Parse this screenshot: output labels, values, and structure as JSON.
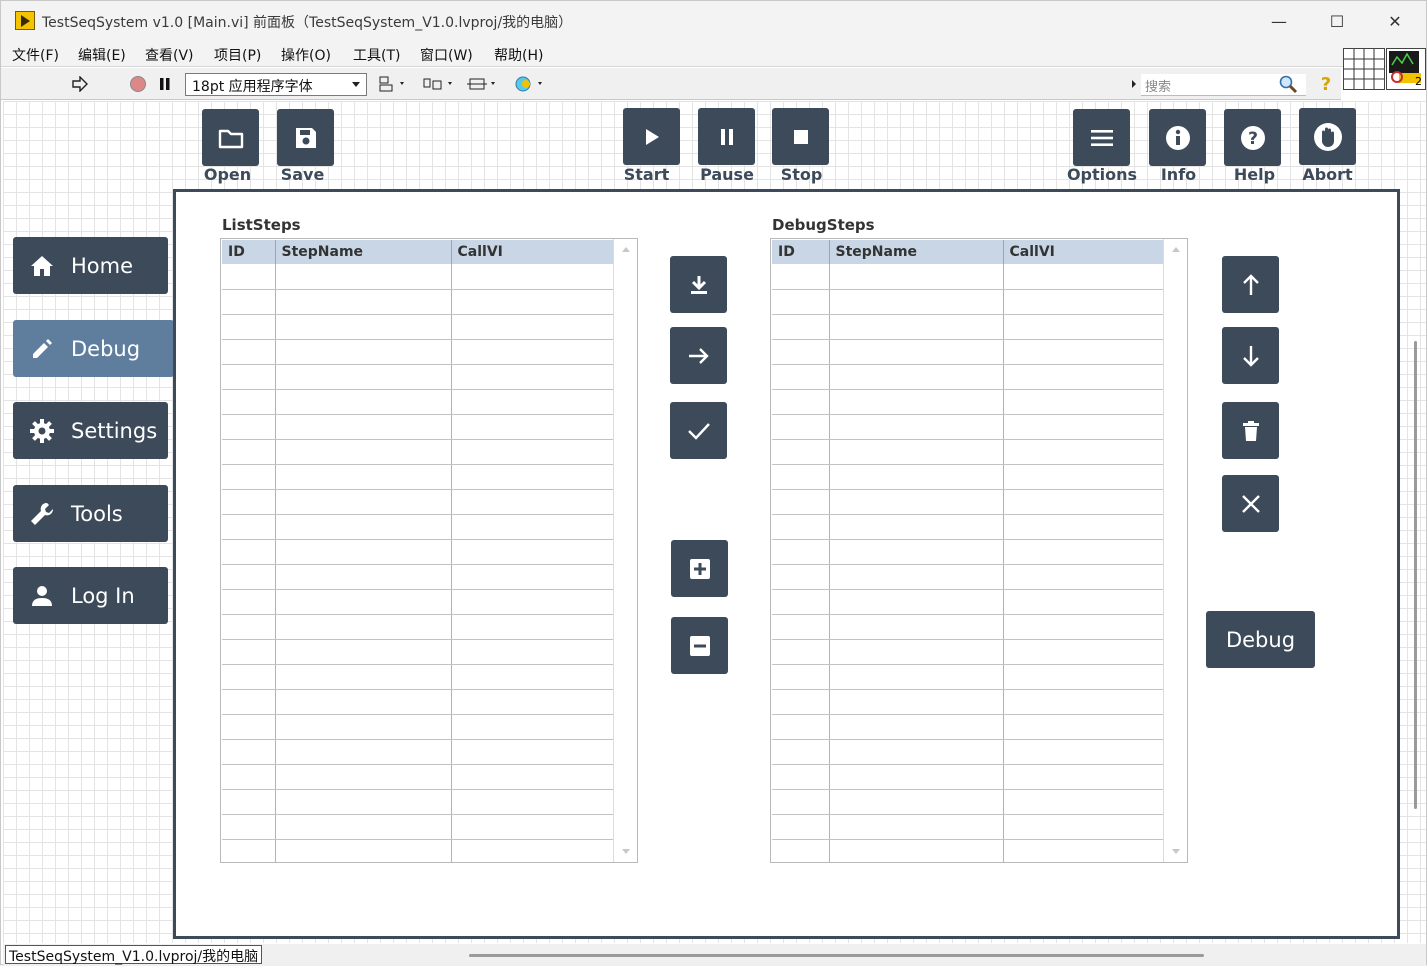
{
  "window": {
    "title": "TestSeqSystem v1.0 [Main.vi] 前面板（TestSeqSystem_V1.0.lvproj/我的电脑）",
    "controls": {
      "minimize": "—",
      "maximize": "☐",
      "close": "✕"
    }
  },
  "menu": [
    "文件(F)",
    "编辑(E)",
    "查看(V)",
    "项目(P)",
    "操作(O)",
    "工具(T)",
    "窗口(W)",
    "帮助(H)"
  ],
  "toolbar": {
    "font": "18pt 应用程序字体",
    "search_placeholder": "搜索",
    "vi_number": "2"
  },
  "top_buttons": {
    "open": "Open",
    "save": "Save",
    "start": "Start",
    "pause": "Pause",
    "stop": "Stop",
    "options": "Options",
    "info": "Info",
    "help": "Help",
    "abort": "Abort"
  },
  "nav": {
    "items": [
      {
        "label": "Home",
        "icon": "home-icon",
        "active": false
      },
      {
        "label": "Debug",
        "icon": "pencil-icon",
        "active": true
      },
      {
        "label": "Settings",
        "icon": "gear-icon",
        "active": false
      },
      {
        "label": "Tools",
        "icon": "wrench-icon",
        "active": false
      },
      {
        "label": "Log In",
        "icon": "user-icon",
        "active": false
      }
    ]
  },
  "list_steps": {
    "title": "ListSteps",
    "columns": [
      "ID",
      "StepName",
      "CallVI"
    ],
    "rows": []
  },
  "debug_steps": {
    "title": "DebugSteps",
    "columns": [
      "ID",
      "StepName",
      "CallVI"
    ],
    "rows": []
  },
  "debug_button": "Debug",
  "status": {
    "path": "TestSeqSystem_V1.0.lvproj/我的电脑"
  },
  "colors": {
    "accent": "#3c4a5a",
    "nav_active": "#5f7e9e",
    "table_header": "#c9d6e6"
  }
}
